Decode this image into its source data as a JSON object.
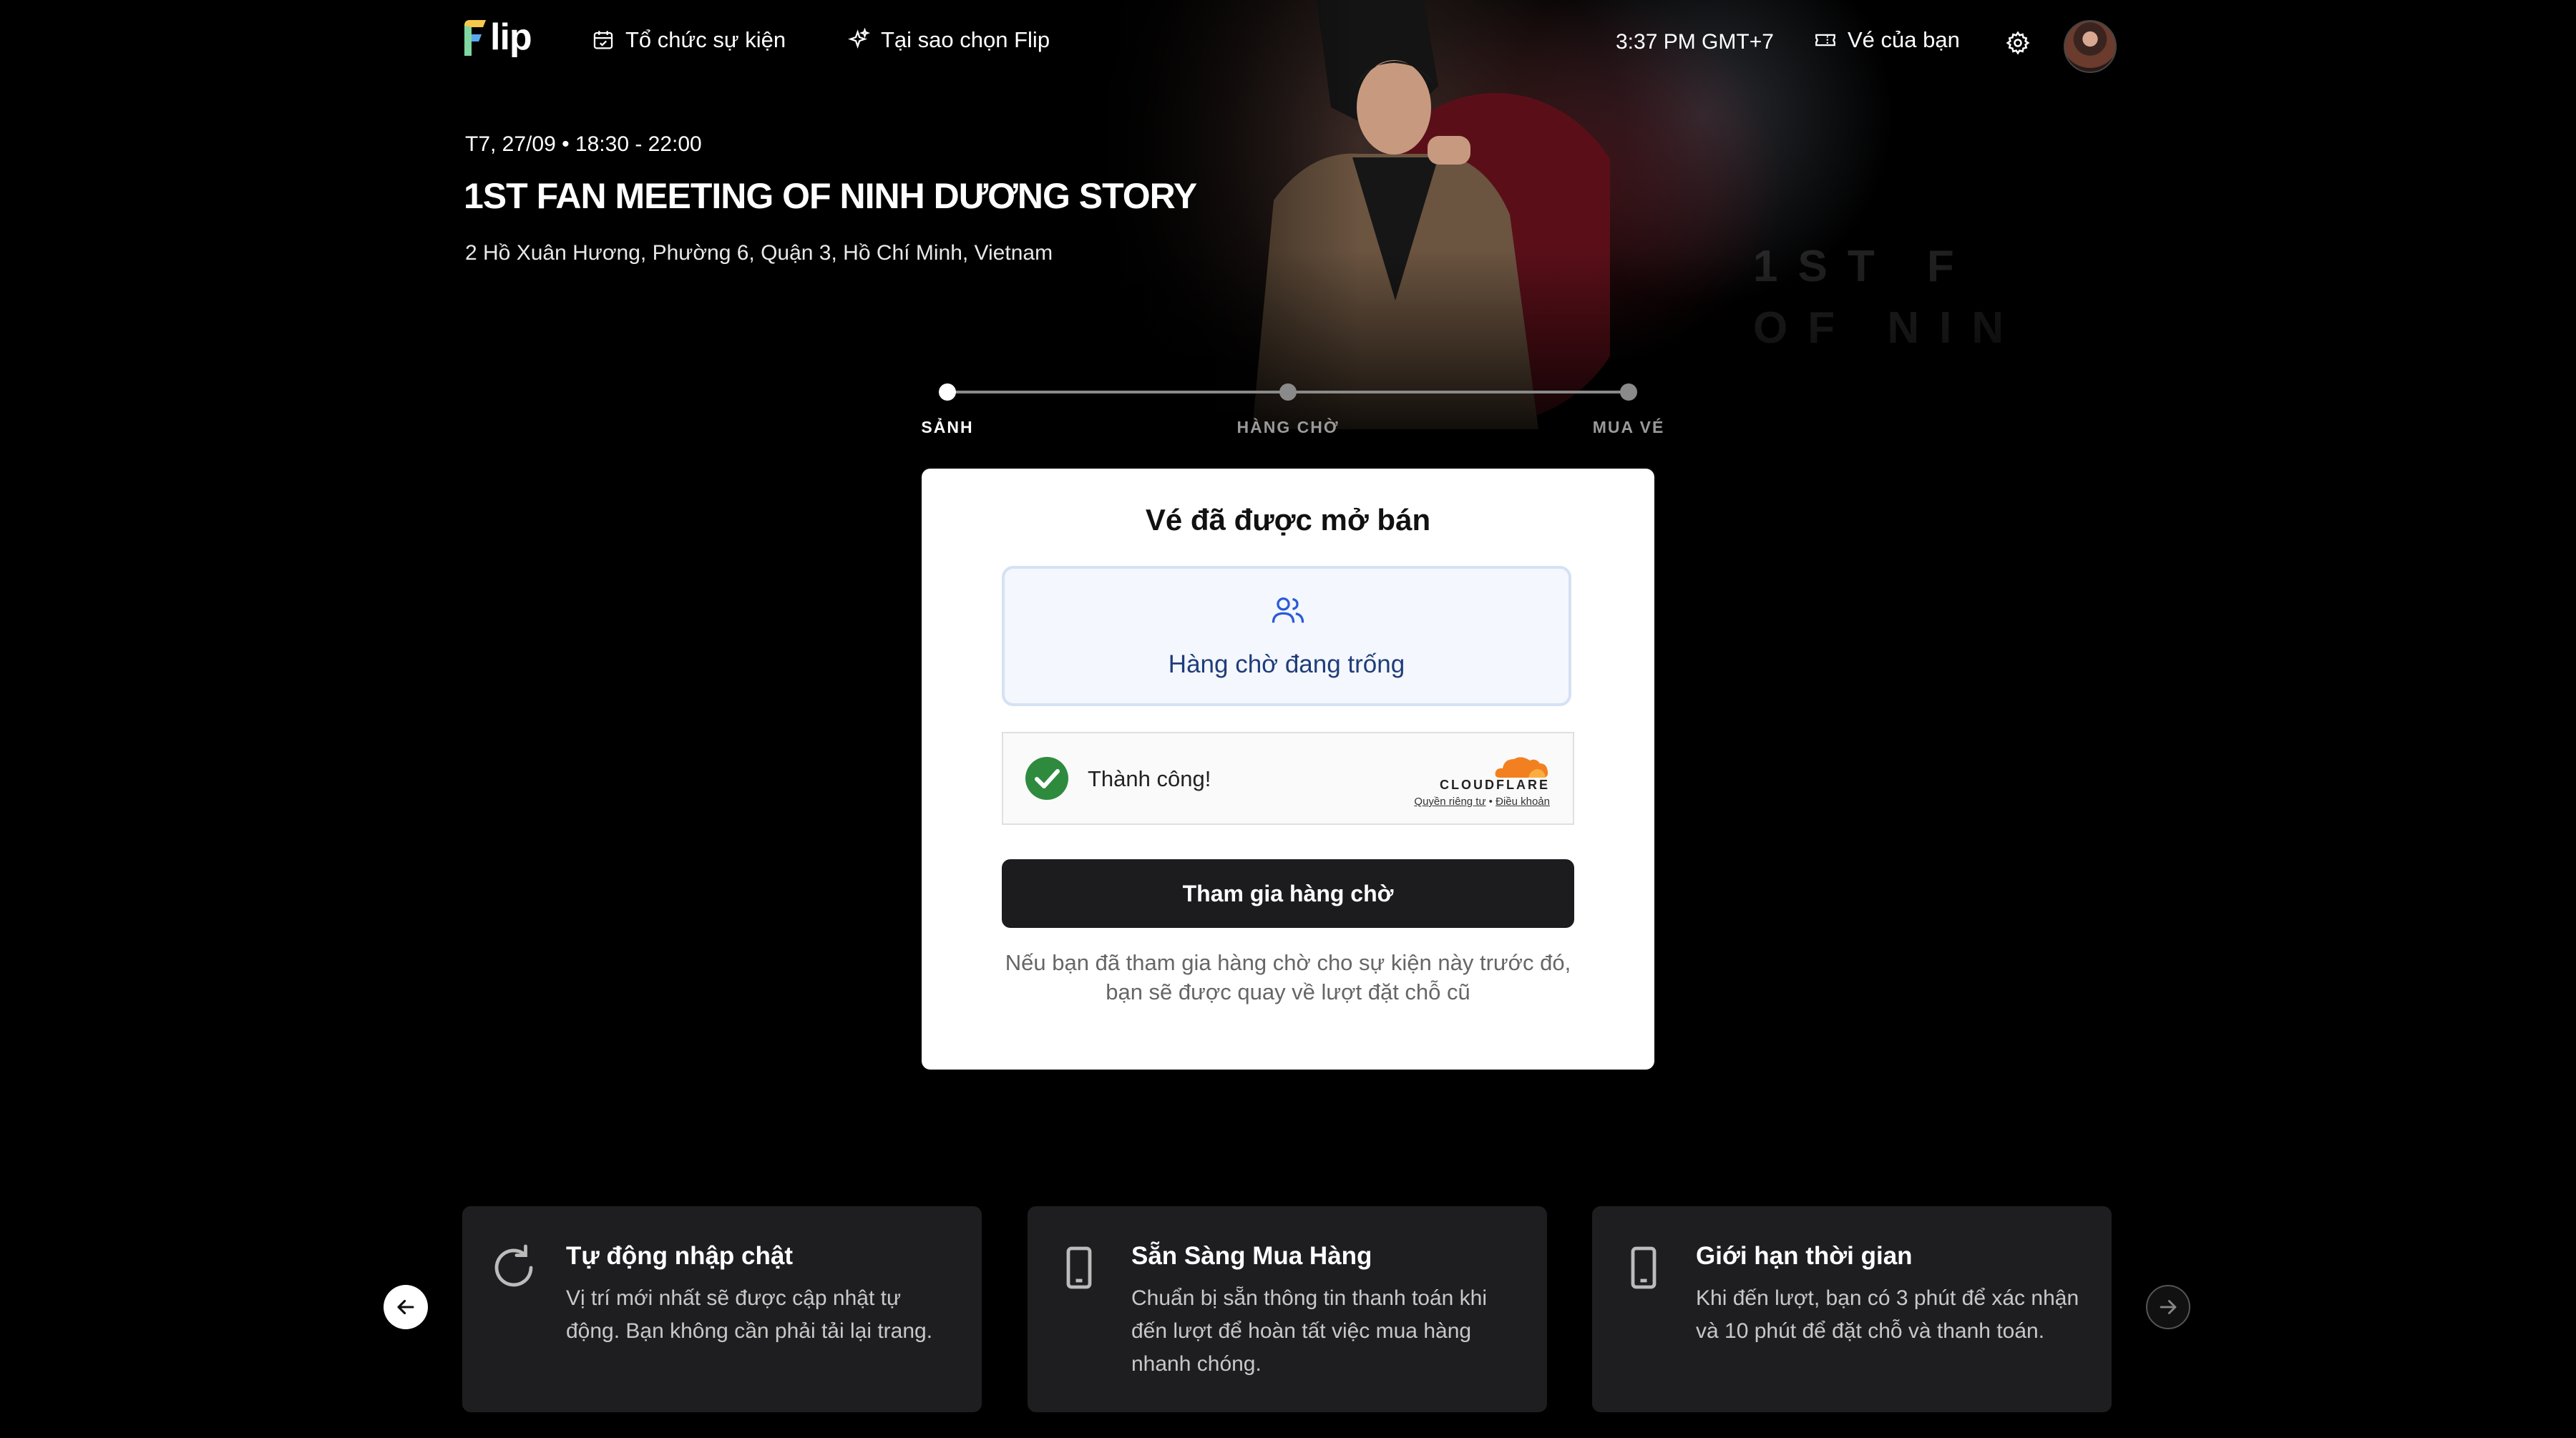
{
  "header": {
    "logo_text": "lip",
    "nav": [
      {
        "label": "Tổ chức sự kiện",
        "icon": "calendar-icon"
      },
      {
        "label": "Tại sao chọn Flip",
        "icon": "sparkle-icon"
      }
    ],
    "time": "3:37 PM GMT+7",
    "tickets_label": "Vé của bạn",
    "tickets_icon": "ticket-icon",
    "settings_icon": "gear-icon"
  },
  "hero": {
    "overlay_text_line1": "1ST F",
    "overlay_text_line2": "OF NIN"
  },
  "event": {
    "datetime": "T7, 27/09 • 18:30 - 22:00",
    "title": "1ST FAN MEETING OF NINH DƯƠNG STORY",
    "address": "2 Hồ Xuân Hương, Phường 6, Quận 3, Hồ Chí Minh, Vietnam"
  },
  "stepper": {
    "steps": [
      {
        "label": "SẢNH",
        "active": true
      },
      {
        "label": "HÀNG CHỜ",
        "active": false
      },
      {
        "label": "MUA VÉ",
        "active": false
      }
    ]
  },
  "card": {
    "title": "Vé đã được mở bán",
    "queue_status": "Hàng chờ đang trống",
    "captcha": {
      "status": "Thành công!",
      "brand": "CLOUDFLARE",
      "privacy_link": "Quyền riêng tư",
      "separator": "•",
      "terms_link": "Điều khoản"
    },
    "join_button": "Tham gia hàng chờ",
    "note": "Nếu bạn đã tham gia hàng chờ cho sự kiện này trước đó, bạn sẽ được quay về lượt đặt chỗ cũ"
  },
  "features": [
    {
      "icon": "refresh-icon",
      "title": "Tự động nhập chật",
      "desc": "Vị trí mới nhất sẽ được cập nhật tự động. Bạn không cần phải tải lại trang."
    },
    {
      "icon": "phone-icon",
      "title": "Sẵn Sàng Mua Hàng",
      "desc": "Chuẩn bị sẵn thông tin thanh toán khi đến lượt để hoàn tất việc mua hàng nhanh chóng."
    },
    {
      "icon": "phone-icon",
      "title": "Giới hạn thời gian",
      "desc": "Khi đến lượt, bạn có 3 phút để xác nhận và 10 phút để đặt chỗ và thanh toán."
    }
  ],
  "colors": {
    "background": "#000000",
    "card": "#ffffff",
    "button": "#1c1c1e",
    "queue_box_bg": "#f4f7fd",
    "queue_text": "#1f3d7a",
    "success_green": "#2e8b3e",
    "cloudflare_orange": "#f38020",
    "feature_card": "#1e1e20"
  }
}
